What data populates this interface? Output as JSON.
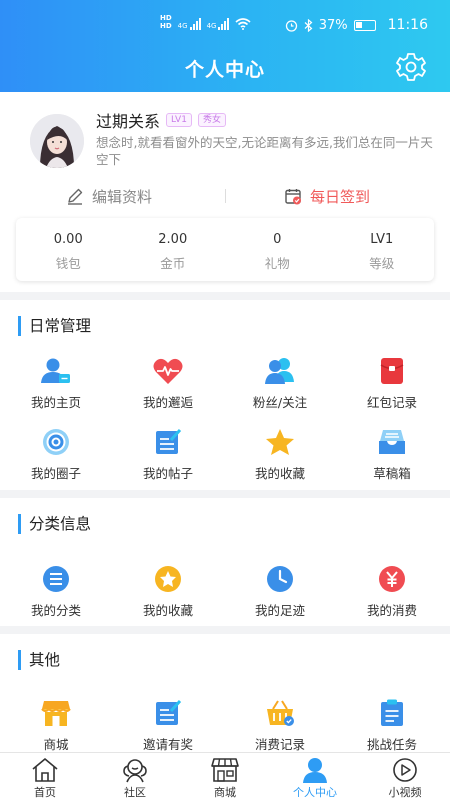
{
  "status_bar": {
    "battery": "37%",
    "time": "11:16",
    "network_tag": "HD",
    "signal_tag": "4G"
  },
  "header": {
    "title": "个人中心",
    "settings_icon": "gear-icon"
  },
  "profile": {
    "name": "过期关系",
    "level_badge": "LV1",
    "gender_badge": "秀女",
    "signature": "想念时,就看看窗外的天空,无论距离有多远,我们总在同一片天空下",
    "edit_label": "编辑资料",
    "checkin_label": "每日签到"
  },
  "stats": [
    {
      "value": "0.00",
      "label": "钱包"
    },
    {
      "value": "2.00",
      "label": "金币"
    },
    {
      "value": "0",
      "label": "礼物"
    },
    {
      "value": "LV1",
      "label": "等级"
    }
  ],
  "sections": {
    "daily": {
      "title": "日常管理",
      "items": [
        {
          "label": "我的主页",
          "icon": "user-card-icon"
        },
        {
          "label": "我的邂逅",
          "icon": "heart-pulse-icon"
        },
        {
          "label": "粉丝/关注",
          "icon": "users-icon"
        },
        {
          "label": "红包记录",
          "icon": "red-packet-icon"
        },
        {
          "label": "我的圈子",
          "icon": "target-icon"
        },
        {
          "label": "我的帖子",
          "icon": "post-icon"
        },
        {
          "label": "我的收藏",
          "icon": "star-icon"
        },
        {
          "label": "草稿箱",
          "icon": "inbox-icon"
        }
      ]
    },
    "category": {
      "title": "分类信息",
      "items": [
        {
          "label": "我的分类",
          "icon": "list-icon"
        },
        {
          "label": "我的收藏",
          "icon": "star-badge-icon"
        },
        {
          "label": "我的足迹",
          "icon": "clock-icon"
        },
        {
          "label": "我的消费",
          "icon": "yen-icon"
        }
      ]
    },
    "other": {
      "title": "其他",
      "items": [
        {
          "label": "商城",
          "icon": "store-icon"
        },
        {
          "label": "邀请有奖",
          "icon": "invite-icon"
        },
        {
          "label": "消费记录",
          "icon": "basket-icon"
        },
        {
          "label": "挑战任务",
          "icon": "clipboard-icon"
        }
      ]
    }
  },
  "tabbar": [
    {
      "label": "首页",
      "icon": "home-icon"
    },
    {
      "label": "社区",
      "icon": "community-icon"
    },
    {
      "label": "商城",
      "icon": "shop-icon"
    },
    {
      "label": "个人中心",
      "icon": "person-icon",
      "active": true
    },
    {
      "label": "小视频",
      "icon": "video-icon"
    }
  ],
  "colors": {
    "accent": "#2e9cf4",
    "checkin": "#f05a5a",
    "header_start": "#2f8ff7",
    "header_end": "#2ec9f0"
  }
}
